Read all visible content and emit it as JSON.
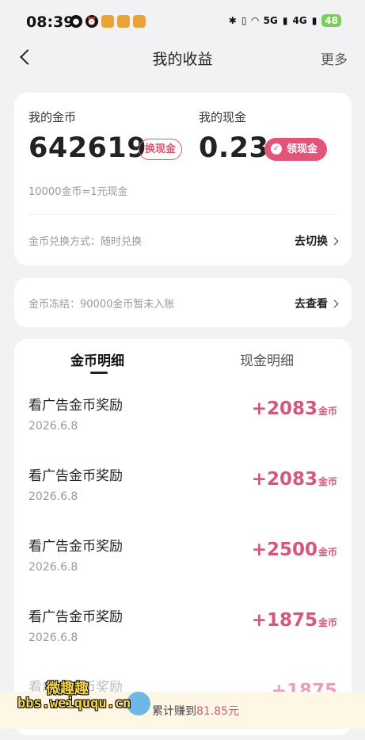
{
  "status_bar": {
    "time": "08:39",
    "signal_labels": [
      "5G",
      "4G"
    ],
    "battery": "48"
  },
  "header": {
    "title": "我的收益",
    "more": "更多"
  },
  "coins": {
    "label": "我的金币",
    "value": "642619",
    "exchange_button": "换现金",
    "rate_text": "10000金币=1元现金",
    "exchange_mode": "金币兑换方式：随时兑换",
    "switch_link": "去切换"
  },
  "cash": {
    "label": "我的现金",
    "value": "0.23",
    "claim_button": "领现金"
  },
  "frozen": {
    "text": "金币冻结：90000金币暂未入账",
    "view_link": "去查看"
  },
  "tabs": {
    "coin_detail": "金币明细",
    "cash_detail": "现金明细"
  },
  "records": [
    {
      "title": "看广告金币奖励",
      "date": "2026.6.8",
      "amount": "+2083",
      "unit": "金币"
    },
    {
      "title": "看广告金币奖励",
      "date": "2026.6.8",
      "amount": "+2083",
      "unit": "金币"
    },
    {
      "title": "看广告金币奖励",
      "date": "2026.6.8",
      "amount": "+2500",
      "unit": "金币"
    },
    {
      "title": "看广告金币奖励",
      "date": "2026.6.8",
      "amount": "+1875",
      "unit": "金币"
    },
    {
      "title": "看广告金币奖励",
      "date": "",
      "amount": "+1875",
      "unit": ""
    }
  ],
  "footer": {
    "earned_prefix": "累计赚到",
    "earned_value": "81.85元"
  },
  "watermark": {
    "line1": "微趣趣",
    "line2": "bbs.weiququ.cn"
  },
  "colors": {
    "accent": "#e1557a",
    "background": "#f2f2f4"
  }
}
